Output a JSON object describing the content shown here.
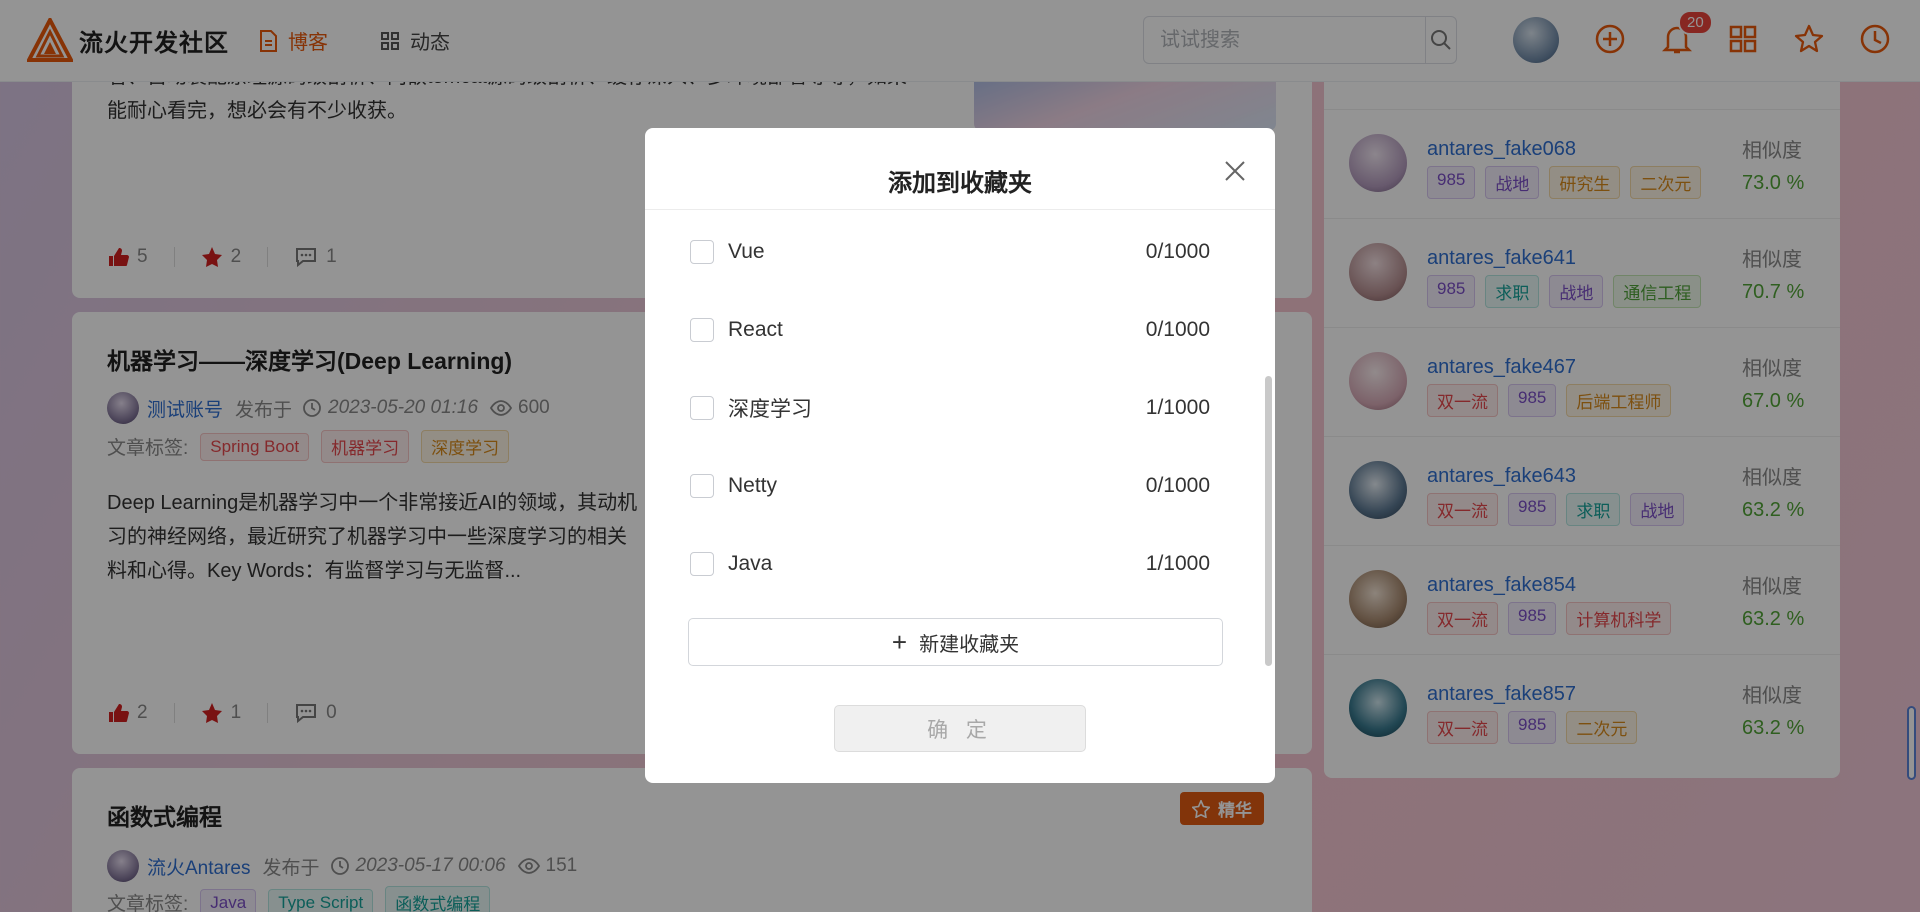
{
  "header": {
    "site_name": "流火开发社区",
    "nav": [
      {
        "label": "博客",
        "icon": "document-icon",
        "active": true
      },
      {
        "label": "动态",
        "icon": "grid-icon",
        "active": false
      }
    ],
    "search_placeholder": "试试搜索",
    "notification_count": "20",
    "accent_color": "#e8590c"
  },
  "posts": [
    {
      "excerpt_line1": "看、自动装配原理源码级剖析、内嵌tomcat源码级剖析、缓存深入、多环境部署等等，如果",
      "excerpt_line2": "能耐心看完，想必会有不少收获。",
      "likes": "5",
      "stars": "2",
      "comments": "1"
    },
    {
      "title": "机器学习——深度学习(Deep Learning)",
      "author": "测试账号",
      "published_label": "发布于",
      "date": "2023-05-20 01:16",
      "views": "600",
      "tags_label": "文章标签:",
      "tags": [
        "Spring Boot",
        "机器学习",
        "深度学习"
      ],
      "excerpt_line1": "Deep Learning是机器学习中一个非常接近AI的领域，其动机",
      "excerpt_line2": "习的神经网络，最近研究了机器学习中一些深度学习的相关",
      "excerpt_line3": "料和心得。Key Words：有监督学习与无监督...",
      "likes": "2",
      "stars": "1",
      "comments": "0"
    },
    {
      "title": "函数式编程",
      "badge": "精华",
      "author": "流火Antares",
      "published_label": "发布于",
      "date": "2023-05-17 00:06",
      "views": "151",
      "tags_label": "文章标签:",
      "tags": [
        "Java",
        "Type Script",
        "函数式编程"
      ]
    }
  ],
  "sidebar": {
    "similarity_label": "相似度",
    "users": [
      {
        "name": "antares_fake068",
        "tags": [
          "985",
          "战地",
          "研究生",
          "二次元"
        ],
        "similarity": "73.0 %"
      },
      {
        "name": "antares_fake641",
        "tags": [
          "985",
          "求职",
          "战地",
          "通信工程"
        ],
        "similarity": "70.7 %"
      },
      {
        "name": "antares_fake467",
        "tags": [
          "双一流",
          "985",
          "后端工程师"
        ],
        "similarity": "67.0 %"
      },
      {
        "name": "antares_fake643",
        "tags": [
          "双一流",
          "985",
          "求职",
          "战地"
        ],
        "similarity": "63.2 %"
      },
      {
        "name": "antares_fake854",
        "tags": [
          "双一流",
          "985",
          "计算机科学"
        ],
        "similarity": "63.2 %"
      },
      {
        "name": "antares_fake857",
        "tags": [
          "双一流",
          "985",
          "二次元"
        ],
        "similarity": "63.2 %"
      }
    ]
  },
  "modal": {
    "title": "添加到收藏夹",
    "folders": [
      {
        "name": "Vue",
        "count": "0/1000"
      },
      {
        "name": "React",
        "count": "0/1000"
      },
      {
        "name": "深度学习",
        "count": "1/1000"
      },
      {
        "name": "Netty",
        "count": "0/1000"
      },
      {
        "name": "Java",
        "count": "1/1000"
      }
    ],
    "new_folder_label": "新建收藏夹",
    "confirm_label": "确 定"
  }
}
